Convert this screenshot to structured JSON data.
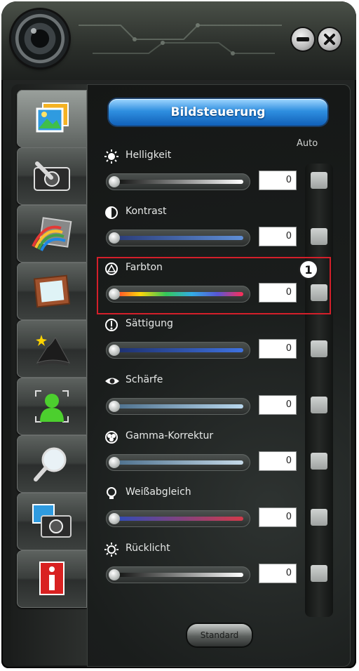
{
  "window": {
    "minimize_icon": "minimize-icon",
    "close_icon": "close-icon",
    "logo_icon": "camera-lens-icon"
  },
  "sidebar": {
    "items": [
      {
        "icon": "picture-icon",
        "active": true
      },
      {
        "icon": "camera-tools-icon",
        "active": false
      },
      {
        "icon": "rainbow-photo-icon",
        "active": false
      },
      {
        "icon": "frame-icon",
        "active": false
      },
      {
        "icon": "wizard-hat-icon",
        "active": false
      },
      {
        "icon": "face-tracking-icon",
        "active": false
      },
      {
        "icon": "zoom-icon",
        "active": false
      },
      {
        "icon": "snapshot-icon",
        "active": false
      },
      {
        "icon": "info-icon",
        "active": false
      }
    ]
  },
  "panel": {
    "title": "Bildsteuerung",
    "auto_label": "Auto",
    "controls": [
      {
        "label": "Helligkeit",
        "value": "0",
        "icon": "brightness-icon",
        "track": "linear-gradient(90deg,#0e0f0e,#ffffff)"
      },
      {
        "label": "Kontrast",
        "value": "0",
        "icon": "contrast-icon",
        "track": "linear-gradient(90deg,#2a3b78,#5f8fd6)"
      },
      {
        "label": "Farbton",
        "value": "0",
        "icon": "hue-icon",
        "track": "linear-gradient(90deg,#ff3b30,#ffd60a,#34c759,#32ade6,#5856d6,#ff2d55)"
      },
      {
        "label": "Sättigung",
        "value": "0",
        "icon": "saturation-icon",
        "track": "linear-gradient(90deg,#1d2f6d,#3f72e0)"
      },
      {
        "label": "Schärfe",
        "value": "0",
        "icon": "sharpness-eye-icon",
        "track": "linear-gradient(90deg,#4c6f8c,#b9d8ee)"
      },
      {
        "label": "Gamma-Korrektur",
        "value": "0",
        "icon": "gamma-icon",
        "track": "linear-gradient(90deg,#4c6f8c,#c5d9e8)"
      },
      {
        "label": "Weißabgleich",
        "value": "0",
        "icon": "white-balance-bulb-icon",
        "track": "linear-gradient(90deg,#2e4cb8,#d23a4a)"
      },
      {
        "label": "Rücklicht",
        "value": "0",
        "icon": "backlight-icon",
        "track": "linear-gradient(90deg,#0e0f0e,#ffffff)"
      }
    ],
    "standard_button": "Standard"
  },
  "annotation": {
    "callout_number": "1",
    "highlight_color": "#d41f2a"
  }
}
